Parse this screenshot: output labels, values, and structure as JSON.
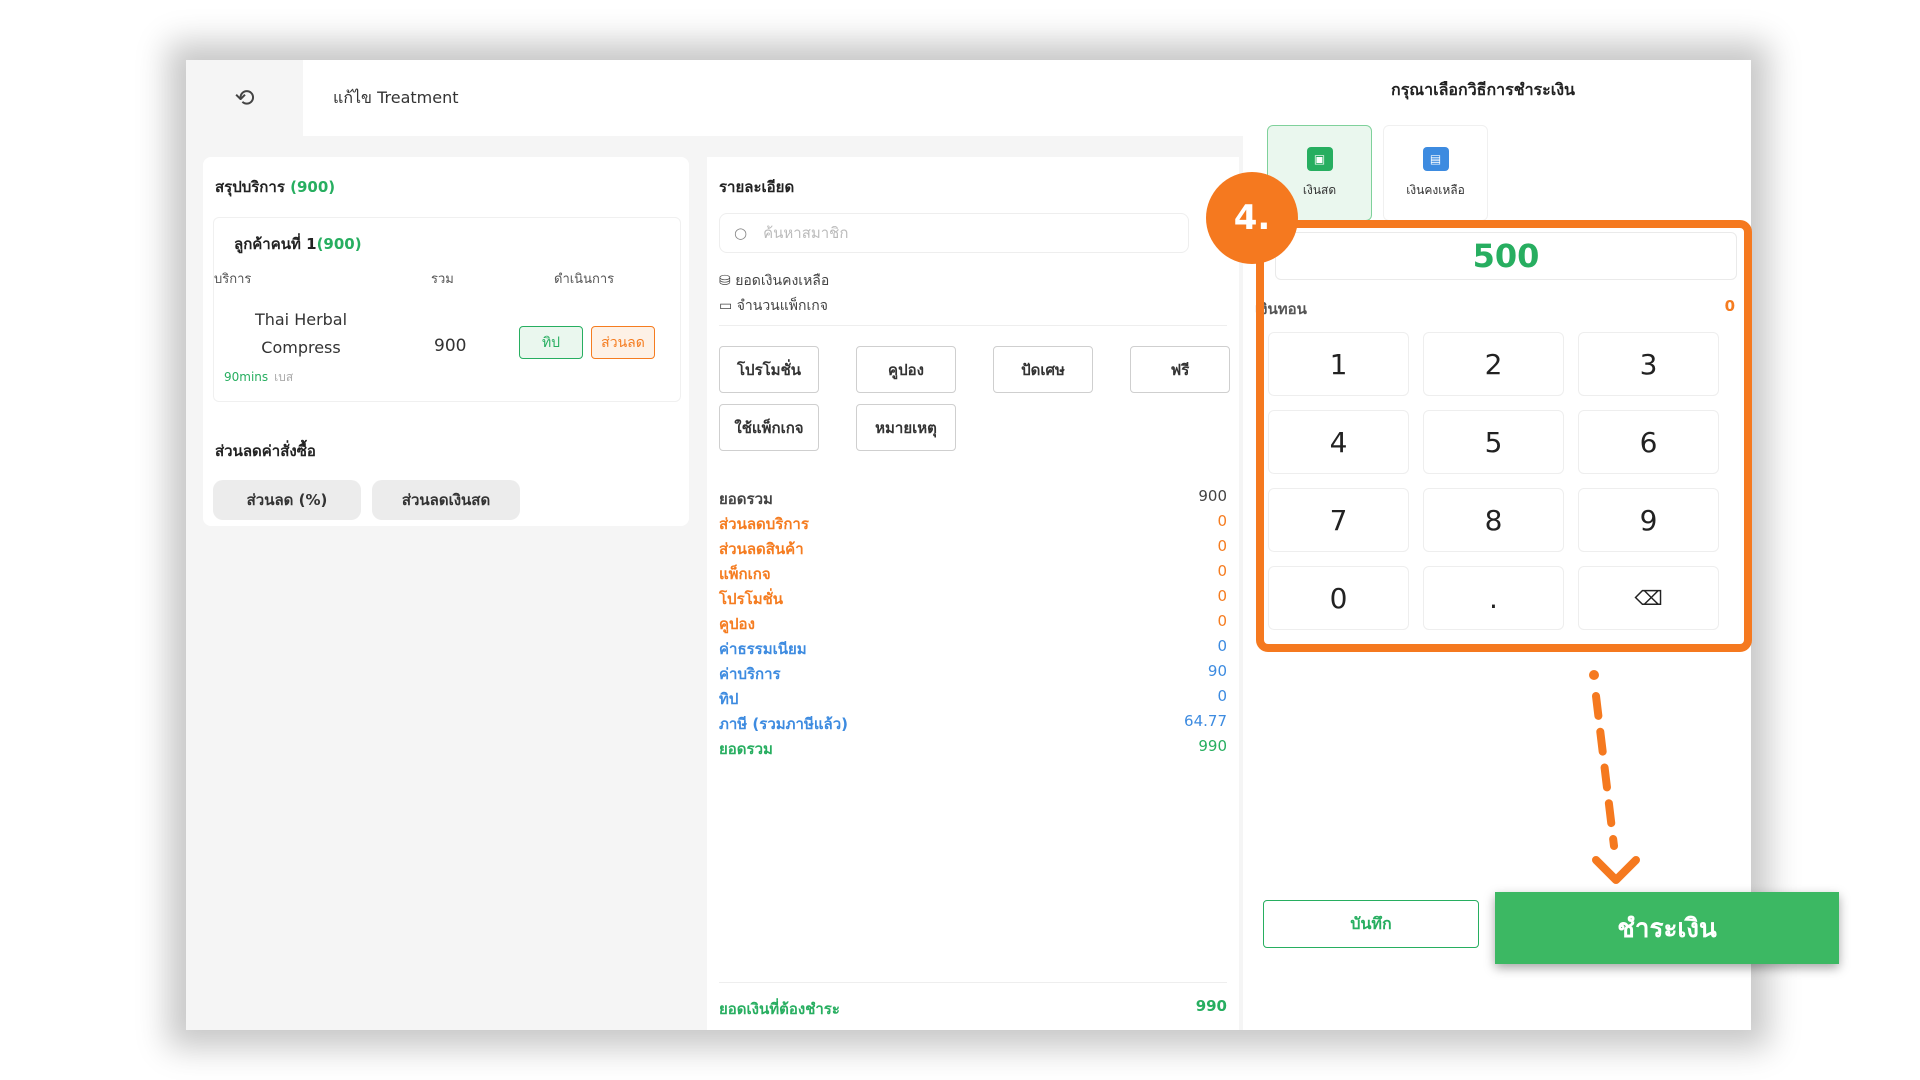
{
  "header": {
    "back_icon": "undo-arrow-icon",
    "title": "แก้ไข Treatment"
  },
  "summary": {
    "title": "สรุปบริการ",
    "total": "(900)",
    "customer": {
      "label": "ลูกค้าคนที่ 1",
      "total": "(900)"
    },
    "columns": {
      "service": "บริการ",
      "sum": "รวม",
      "action": "ดำเนินการ"
    },
    "service": {
      "name": "Thai Herbal Compress",
      "duration": "90mins",
      "staff": "เบส",
      "total": "900",
      "tip_label": "ทิป",
      "discount_label": "ส่วนลด"
    },
    "order_discount_title": "ส่วนลดค่าสั่งซื้อ",
    "discount_percent_label": "ส่วนลด (%)",
    "discount_cash_label": "ส่วนลดเงินสด"
  },
  "details": {
    "title": "รายละเอียด",
    "search_placeholder": "ค้นหาสมาชิก",
    "balance_label": "ยอดเงินคงเหลือ",
    "package_count_label": "จำนวนแพ็กเกจ",
    "buttons": [
      "โปรโมชั่น",
      "คูปอง",
      "ปัดเศษ",
      "ฟรี",
      "ใช้แพ็กเกจ",
      "หมายเหตุ"
    ],
    "lines": [
      {
        "label": "ยอดรวม",
        "value": "900",
        "color": "#444444"
      },
      {
        "label": "ส่วนลดบริการ",
        "value": "0",
        "color": "#f57c20"
      },
      {
        "label": "ส่วนลดสินค้า",
        "value": "0",
        "color": "#f57c20"
      },
      {
        "label": "แพ็กเกจ",
        "value": "0",
        "color": "#f57c20"
      },
      {
        "label": "โปรโมชั่น",
        "value": "0",
        "color": "#f57c20"
      },
      {
        "label": "คูปอง",
        "value": "0",
        "color": "#f57c20"
      },
      {
        "label": "ค่าธรรมเนียม",
        "value": "0",
        "color": "#3d8be0"
      },
      {
        "label": "ค่าบริการ",
        "value": "90",
        "color": "#3d8be0"
      },
      {
        "label": "ทิป",
        "value": "0",
        "color": "#3d8be0"
      },
      {
        "label": "ภาษี (รวมภาษีแล้ว)",
        "value": "64.77",
        "color": "#3d8be0"
      },
      {
        "label": "ยอดรวม",
        "value": "990",
        "color": "#27ae60"
      }
    ],
    "amount_due_label": "ยอดเงินที่ต้องชำระ",
    "amount_due_value": "990"
  },
  "payment": {
    "title": "กรุณาเลือกวิธีการชำระเงิน",
    "tabs": [
      {
        "label": "เงินสด",
        "icon": "cash-icon",
        "color": "#27ae60"
      },
      {
        "label": "เงินคงเหลือ",
        "icon": "wallet-icon",
        "color": "#3d8be0"
      }
    ],
    "amount": "500",
    "change_label": "เงินทอน",
    "change_value": "0",
    "keys": [
      "1",
      "2",
      "3",
      "4",
      "5",
      "6",
      "7",
      "8",
      "9",
      "0",
      ".",
      "⌫"
    ],
    "save_label": "บันทึก",
    "pay_label": "ชำระเงิน"
  },
  "annotation": {
    "step_label": "4.",
    "accent_color": "#f5791f"
  }
}
